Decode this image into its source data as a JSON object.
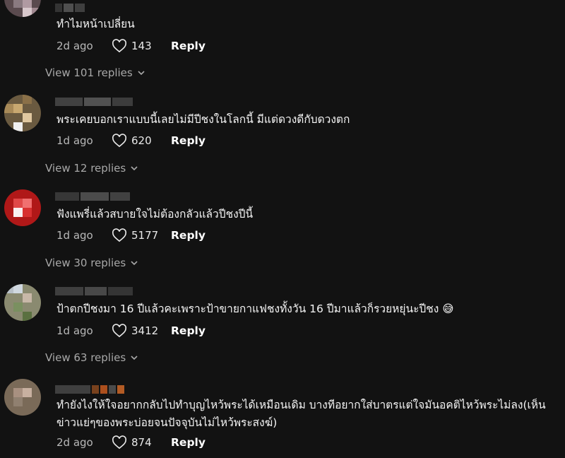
{
  "comments": [
    {
      "text": "ทำไมหน้าเปลี่ยน",
      "date": "2d ago",
      "likes": "143",
      "reply_label": "Reply",
      "view_replies": "View 101 replies"
    },
    {
      "text": "พระเคยบอกเราแบบนี้เลยไม่มีปีชงในโลกนี้ มีแต่ดวงดีกับดวงตก",
      "date": "1d ago",
      "likes": "620",
      "reply_label": "Reply",
      "view_replies": "View 12 replies"
    },
    {
      "text": "ฟังแพรี่แล้วสบายใจไม่ต้องกลัวแล้วปีชงปีนี้",
      "date": "1d ago",
      "likes": "5177",
      "reply_label": "Reply",
      "view_replies": "View 30 replies"
    },
    {
      "text": "ป้าตกปีชงมา 16 ปีแล้วคะเพราะป้าขายกาแฟชงทั้งวัน 16 ปีมาแล้วก็รวยหยุ่นะปีชง 😅",
      "date": "1d ago",
      "likes": "3412",
      "reply_label": "Reply",
      "view_replies": "View 63 replies"
    },
    {
      "text": "ทำยังไงให้ใจอยากกลับไปทำบุญไหว้พระได้เหมือนเดิม บางทีอยากใส่บาตรแต่ใจมันอคติไหว้พระไม่ลง(เห็นข่าวแย่ๆของพระบ่อยจนปัจจุบันไม่ไหว้พระสงฆ์)",
      "date": "2d ago",
      "likes": "874",
      "reply_label": "Reply"
    }
  ],
  "colors": {
    "background": "#121212",
    "text": "#f4f4f4",
    "muted": "#a8a8a8"
  },
  "icons": {
    "like": "heart-outline-icon",
    "expand": "chevron-down-icon"
  }
}
